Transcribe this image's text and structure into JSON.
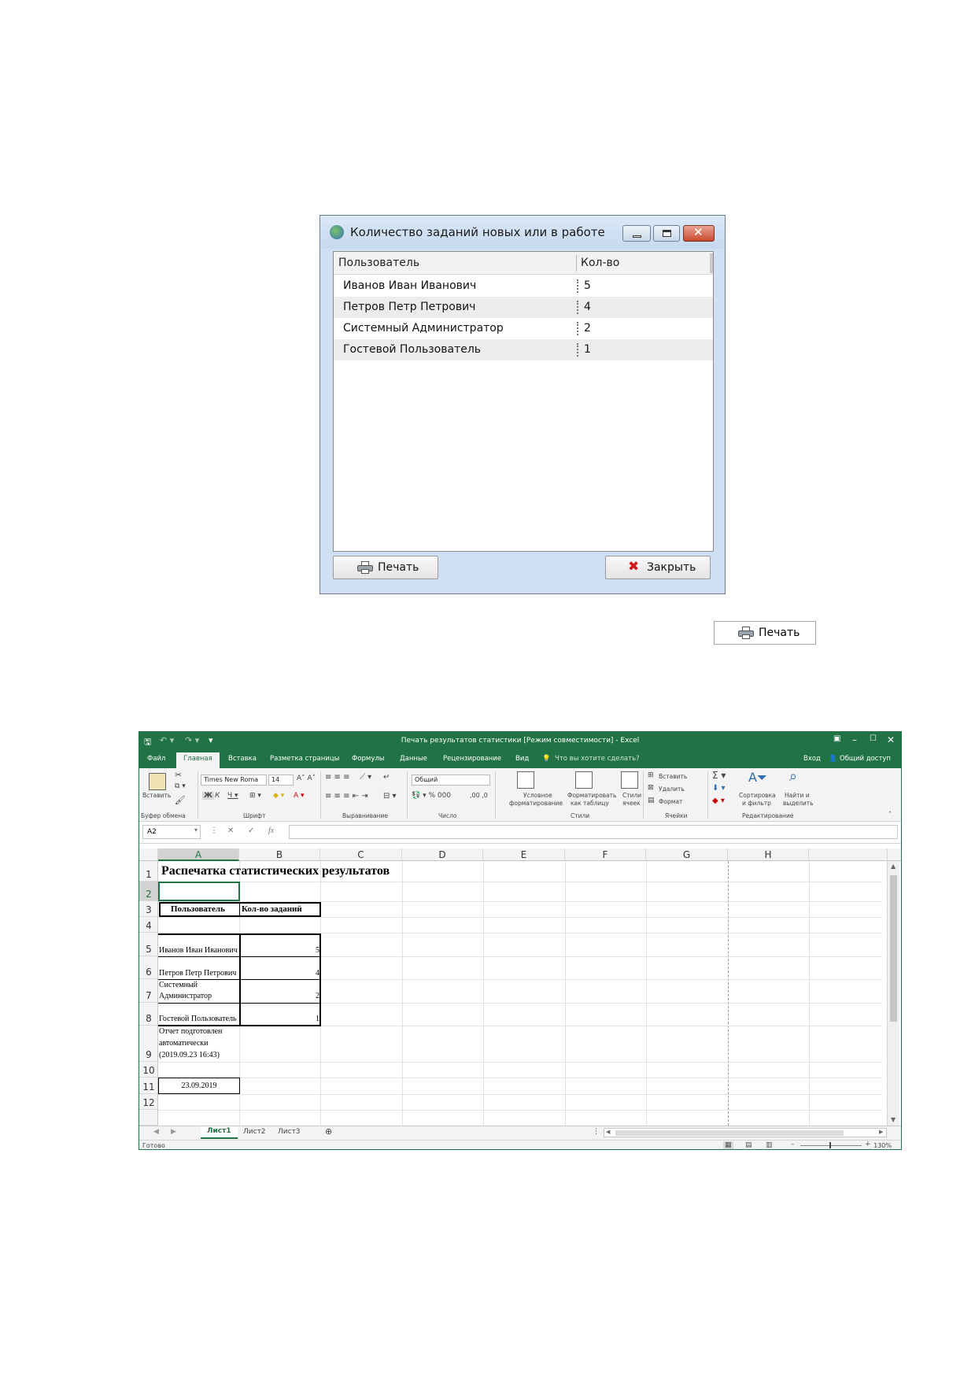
{
  "dialog": {
    "title": "Количество заданий новых или в работе",
    "columns": [
      "Пользователь",
      "Кол-во"
    ],
    "rows": [
      {
        "name": "Иванов Иван Иванович",
        "count": "5"
      },
      {
        "name": "Петров Петр Петрович",
        "count": "4"
      },
      {
        "name": "Системный Администратор",
        "count": "2"
      },
      {
        "name": "Гостевой Пользователь",
        "count": "1"
      }
    ],
    "print_label": "Печать",
    "close_label": "Закрыть"
  },
  "solo_button": {
    "label": "Печать"
  },
  "excel": {
    "title": "Печать результатов статистики  [Режим совместимости] - Excel",
    "tabs": [
      "Файл",
      "Главная",
      "Вставка",
      "Разметка страницы",
      "Формулы",
      "Данные",
      "Рецензирование",
      "Вид"
    ],
    "tell_me": "Что вы хотите сделать?",
    "signin": "Вход",
    "share": "Общий доступ",
    "ribbon": {
      "paste": "Вставить",
      "clipboard_group": "Буфер обмена",
      "font_name": "Times New Roma",
      "font_size": "14",
      "font_group": "Шрифт",
      "align_group": "Выравнивание",
      "number_format": "Общий",
      "number_group": "Число",
      "cond_format_1": "Условное",
      "cond_format_2": "форматирование",
      "format_table_1": "Форматировать",
      "format_table_2": "как таблицу",
      "cell_styles_1": "Стили",
      "cell_styles_2": "ячеек",
      "styles_group": "Стили",
      "insert": "Вставить",
      "delete": "Удалить",
      "format": "Формат",
      "cells_group": "Ячейки",
      "sort_1": "Сортировка",
      "sort_2": "и фильтр",
      "find_1": "Найти и",
      "find_2": "выделить",
      "edit_group": "Редактирование"
    },
    "namebox": "A2",
    "columns": [
      "A",
      "B",
      "C",
      "D",
      "E",
      "F",
      "G",
      "H"
    ],
    "row_numbers": [
      "1",
      "2",
      "3",
      "4",
      "5",
      "6",
      "7",
      "8",
      "9",
      "10",
      "11",
      "12"
    ],
    "cells": {
      "title": "Распечатка статистических результатов",
      "hdr_user": "Пользователь",
      "hdr_count": "Кол-во заданий",
      "r5a": "Иванов Иван Иванович",
      "r5b": "5",
      "r6a": "Петров Петр Петрович",
      "r6b": "4",
      "r7a_1": "Системный",
      "r7a_2": "Администратор",
      "r7b": "2",
      "r8a": "Гостевой Пользователь",
      "r8b": "1",
      "r9_1": "Отчет подготовлен",
      "r9_2": "автоматически",
      "r9_3": "(2019.09.23 16:43)",
      "r11": "23.09.2019"
    },
    "sheets": [
      "Лист1",
      "Лист2",
      "Лист3"
    ],
    "status": "Готово",
    "zoom": "130%",
    "accent": "#217346"
  }
}
